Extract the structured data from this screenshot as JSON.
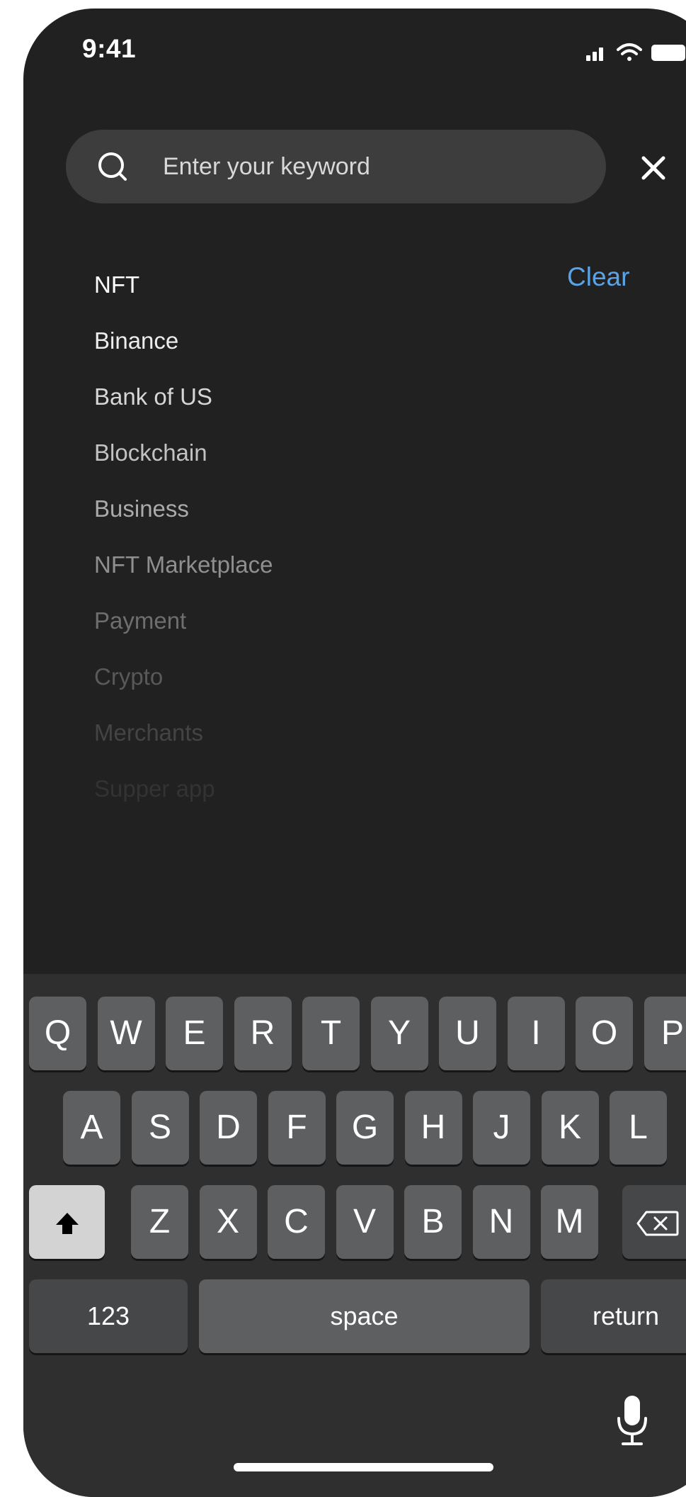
{
  "status_bar": {
    "time": "9:41",
    "icons": [
      "signal-icon",
      "wifi-icon",
      "battery-icon"
    ]
  },
  "search": {
    "value": "",
    "placeholder": "Enter your keyword",
    "icon": "search-icon",
    "close_icon": "close-icon"
  },
  "recent": {
    "clear_label": "Clear",
    "items": [
      {
        "label": "NFT",
        "color": "#ffffff"
      },
      {
        "label": "Binance",
        "color": "#ececec"
      },
      {
        "label": "Bank of US",
        "color": "#d6d6d6"
      },
      {
        "label": "Blockchain",
        "color": "#c2c2c2"
      },
      {
        "label": "Business",
        "color": "#aaaaaa"
      },
      {
        "label": "NFT Marketplace",
        "color": "#8f8f8f"
      },
      {
        "label": "Payment",
        "color": "#6e6e6e"
      },
      {
        "label": "Crypto",
        "color": "#595959"
      },
      {
        "label": "Merchants",
        "color": "#444444"
      },
      {
        "label": "Supper app",
        "color": "#333333"
      }
    ]
  },
  "keyboard": {
    "row1": [
      "Q",
      "W",
      "E",
      "R",
      "T",
      "Y",
      "U",
      "I",
      "O",
      "P"
    ],
    "row2": [
      "A",
      "S",
      "D",
      "F",
      "G",
      "H",
      "J",
      "K",
      "L"
    ],
    "row3": [
      "Z",
      "X",
      "C",
      "V",
      "B",
      "N",
      "M"
    ],
    "numbers_label": "123",
    "space_label": "space",
    "return_label": "return",
    "shift_icon": "shift-icon",
    "delete_icon": "delete-icon",
    "mic_icon": "microphone-icon"
  },
  "colors": {
    "background": "#212121",
    "accent": "#5aa3e8",
    "key": "#5e5f61",
    "key_dark": "#464749"
  }
}
